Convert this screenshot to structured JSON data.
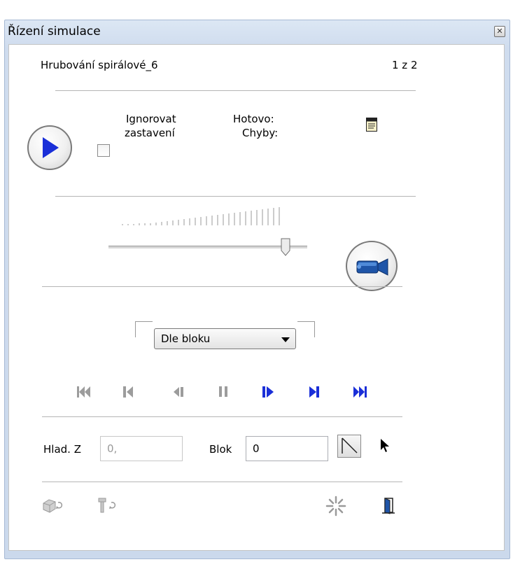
{
  "window": {
    "title": "Řízení simulace"
  },
  "header": {
    "operation_name": "Hrubování spirálové_6",
    "counter": "1 z 2"
  },
  "run": {
    "ignore_stop_label_line1": "Ignorovat",
    "ignore_stop_label_line2": "zastavení",
    "ignore_stop_checked": false,
    "done_label": "Hotovo:",
    "errors_label": "Chyby:"
  },
  "speed": {
    "level": 0.89
  },
  "stepping": {
    "mode_value": "Dle bloku"
  },
  "fields": {
    "z_level_label": "Hlad. Z",
    "z_level_value": "0,",
    "block_label": "Blok",
    "block_value": "0"
  },
  "colors": {
    "accent_blue": "#1a2fd8",
    "disabled_gray": "#9c9c9c",
    "title_bar": "#cfdcee"
  },
  "icons": {
    "play": "play-icon",
    "report": "report-icon",
    "camera": "video-camera-icon",
    "goto_start": "skip-to-start-icon",
    "step_back": "step-back-icon",
    "step_back_small": "step-back-small-icon",
    "pause": "pause-icon",
    "step_forward_small": "step-forward-small-icon",
    "step_forward": "step-forward-icon",
    "goto_end": "skip-to-end-icon",
    "tool_path": "tool-path-icon",
    "pointer": "pointer-icon",
    "stock_refresh": "stock-refresh-icon",
    "tool_refresh": "tool-refresh-icon",
    "settings": "sparkle-icon",
    "exit": "exit-door-icon"
  }
}
